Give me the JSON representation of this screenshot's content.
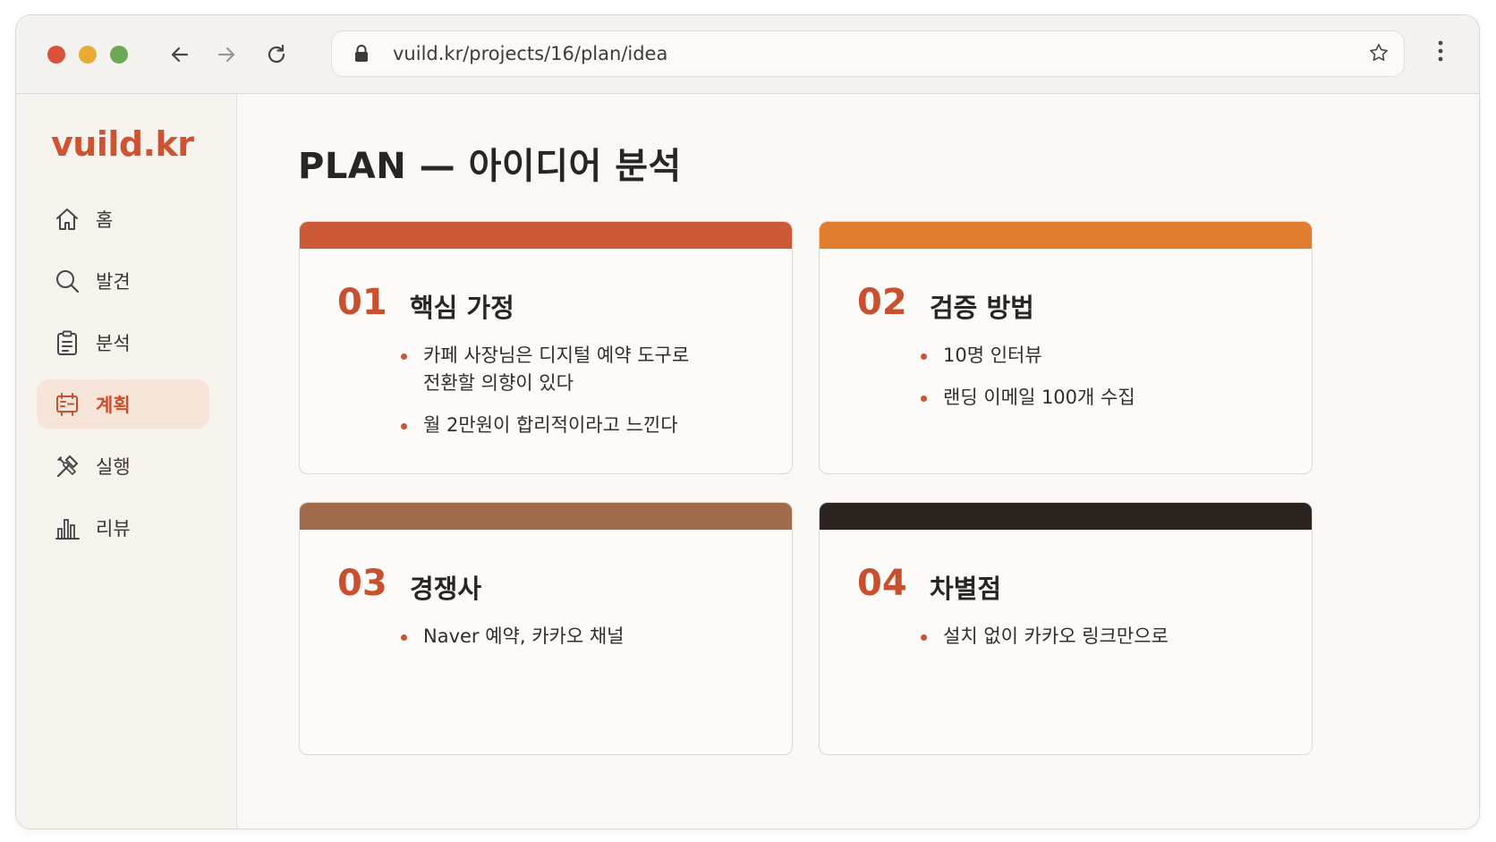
{
  "browser": {
    "url": "vuild.kr/projects/16/plan/idea"
  },
  "sidebar": {
    "logo": "vuild.kr",
    "items": [
      {
        "label": "홈",
        "icon": "home-icon",
        "active": false
      },
      {
        "label": "발견",
        "icon": "search-icon",
        "active": false
      },
      {
        "label": "분석",
        "icon": "clipboard-icon",
        "active": false
      },
      {
        "label": "계획",
        "icon": "plan-board-icon",
        "active": true
      },
      {
        "label": "실행",
        "icon": "tools-icon",
        "active": false
      },
      {
        "label": "리뷰",
        "icon": "bar-chart-icon",
        "active": false
      }
    ]
  },
  "main": {
    "title": "PLAN — 아이디어 분석",
    "cards": [
      {
        "number": "01",
        "title": "핵심 가정",
        "accent": "#cd5a37",
        "bullets": [
          "카페 사장님은 디지털 예약 도구로 전환할 의향이 있다",
          "월 2만원이 합리적이라고 느낀다"
        ]
      },
      {
        "number": "02",
        "title": "검증 방법",
        "accent": "#e07d2e",
        "bullets": [
          "10명 인터뷰",
          "랜딩 이메일 100개 수집"
        ]
      },
      {
        "number": "03",
        "title": "경쟁사",
        "accent": "#a06c4b",
        "bullets": [
          "Naver 예약, 카카오 채널"
        ]
      },
      {
        "number": "04",
        "title": "차별점",
        "accent": "#2c2421",
        "bullets": [
          "설치 없이 카카오 링크만으로"
        ]
      }
    ]
  },
  "colors": {
    "brand": "#cc5433",
    "active_bg": "#f7e4d9"
  }
}
